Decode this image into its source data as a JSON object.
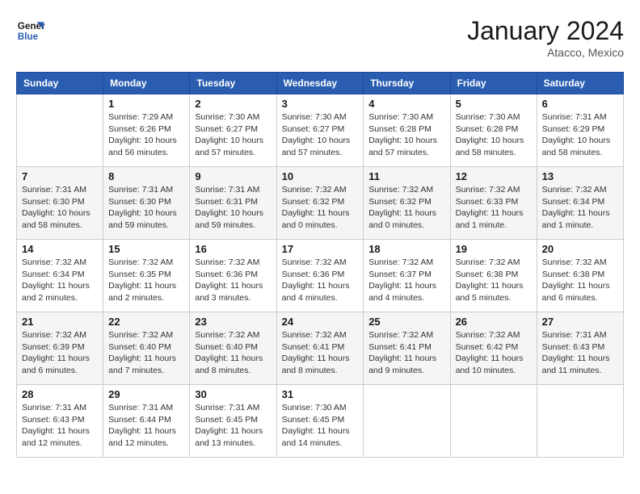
{
  "header": {
    "logo_line1": "General",
    "logo_line2": "Blue",
    "month": "January 2024",
    "location": "Atacco, Mexico"
  },
  "weekdays": [
    "Sunday",
    "Monday",
    "Tuesday",
    "Wednesday",
    "Thursday",
    "Friday",
    "Saturday"
  ],
  "weeks": [
    [
      {
        "day": "",
        "info": ""
      },
      {
        "day": "1",
        "info": "Sunrise: 7:29 AM\nSunset: 6:26 PM\nDaylight: 10 hours\nand 56 minutes."
      },
      {
        "day": "2",
        "info": "Sunrise: 7:30 AM\nSunset: 6:27 PM\nDaylight: 10 hours\nand 57 minutes."
      },
      {
        "day": "3",
        "info": "Sunrise: 7:30 AM\nSunset: 6:27 PM\nDaylight: 10 hours\nand 57 minutes."
      },
      {
        "day": "4",
        "info": "Sunrise: 7:30 AM\nSunset: 6:28 PM\nDaylight: 10 hours\nand 57 minutes."
      },
      {
        "day": "5",
        "info": "Sunrise: 7:30 AM\nSunset: 6:28 PM\nDaylight: 10 hours\nand 58 minutes."
      },
      {
        "day": "6",
        "info": "Sunrise: 7:31 AM\nSunset: 6:29 PM\nDaylight: 10 hours\nand 58 minutes."
      }
    ],
    [
      {
        "day": "7",
        "info": "Sunrise: 7:31 AM\nSunset: 6:30 PM\nDaylight: 10 hours\nand 58 minutes."
      },
      {
        "day": "8",
        "info": "Sunrise: 7:31 AM\nSunset: 6:30 PM\nDaylight: 10 hours\nand 59 minutes."
      },
      {
        "day": "9",
        "info": "Sunrise: 7:31 AM\nSunset: 6:31 PM\nDaylight: 10 hours\nand 59 minutes."
      },
      {
        "day": "10",
        "info": "Sunrise: 7:32 AM\nSunset: 6:32 PM\nDaylight: 11 hours\nand 0 minutes."
      },
      {
        "day": "11",
        "info": "Sunrise: 7:32 AM\nSunset: 6:32 PM\nDaylight: 11 hours\nand 0 minutes."
      },
      {
        "day": "12",
        "info": "Sunrise: 7:32 AM\nSunset: 6:33 PM\nDaylight: 11 hours\nand 1 minute."
      },
      {
        "day": "13",
        "info": "Sunrise: 7:32 AM\nSunset: 6:34 PM\nDaylight: 11 hours\nand 1 minute."
      }
    ],
    [
      {
        "day": "14",
        "info": "Sunrise: 7:32 AM\nSunset: 6:34 PM\nDaylight: 11 hours\nand 2 minutes."
      },
      {
        "day": "15",
        "info": "Sunrise: 7:32 AM\nSunset: 6:35 PM\nDaylight: 11 hours\nand 2 minutes."
      },
      {
        "day": "16",
        "info": "Sunrise: 7:32 AM\nSunset: 6:36 PM\nDaylight: 11 hours\nand 3 minutes."
      },
      {
        "day": "17",
        "info": "Sunrise: 7:32 AM\nSunset: 6:36 PM\nDaylight: 11 hours\nand 4 minutes."
      },
      {
        "day": "18",
        "info": "Sunrise: 7:32 AM\nSunset: 6:37 PM\nDaylight: 11 hours\nand 4 minutes."
      },
      {
        "day": "19",
        "info": "Sunrise: 7:32 AM\nSunset: 6:38 PM\nDaylight: 11 hours\nand 5 minutes."
      },
      {
        "day": "20",
        "info": "Sunrise: 7:32 AM\nSunset: 6:38 PM\nDaylight: 11 hours\nand 6 minutes."
      }
    ],
    [
      {
        "day": "21",
        "info": "Sunrise: 7:32 AM\nSunset: 6:39 PM\nDaylight: 11 hours\nand 6 minutes."
      },
      {
        "day": "22",
        "info": "Sunrise: 7:32 AM\nSunset: 6:40 PM\nDaylight: 11 hours\nand 7 minutes."
      },
      {
        "day": "23",
        "info": "Sunrise: 7:32 AM\nSunset: 6:40 PM\nDaylight: 11 hours\nand 8 minutes."
      },
      {
        "day": "24",
        "info": "Sunrise: 7:32 AM\nSunset: 6:41 PM\nDaylight: 11 hours\nand 8 minutes."
      },
      {
        "day": "25",
        "info": "Sunrise: 7:32 AM\nSunset: 6:41 PM\nDaylight: 11 hours\nand 9 minutes."
      },
      {
        "day": "26",
        "info": "Sunrise: 7:32 AM\nSunset: 6:42 PM\nDaylight: 11 hours\nand 10 minutes."
      },
      {
        "day": "27",
        "info": "Sunrise: 7:31 AM\nSunset: 6:43 PM\nDaylight: 11 hours\nand 11 minutes."
      }
    ],
    [
      {
        "day": "28",
        "info": "Sunrise: 7:31 AM\nSunset: 6:43 PM\nDaylight: 11 hours\nand 12 minutes."
      },
      {
        "day": "29",
        "info": "Sunrise: 7:31 AM\nSunset: 6:44 PM\nDaylight: 11 hours\nand 12 minutes."
      },
      {
        "day": "30",
        "info": "Sunrise: 7:31 AM\nSunset: 6:45 PM\nDaylight: 11 hours\nand 13 minutes."
      },
      {
        "day": "31",
        "info": "Sunrise: 7:30 AM\nSunset: 6:45 PM\nDaylight: 11 hours\nand 14 minutes."
      },
      {
        "day": "",
        "info": ""
      },
      {
        "day": "",
        "info": ""
      },
      {
        "day": "",
        "info": ""
      }
    ]
  ]
}
